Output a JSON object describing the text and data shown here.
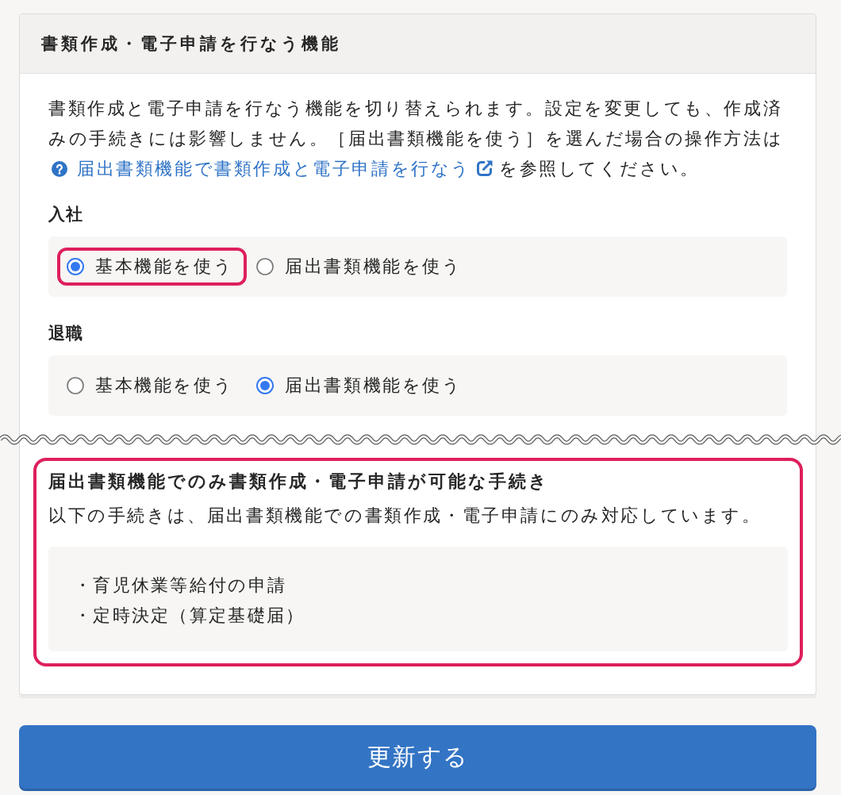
{
  "panel": {
    "title": "書類作成・電子申請を行なう機能",
    "description": {
      "text": "書類作成と電子申請を行なう機能を切り替えられます。設定を変更しても、作成済みの手続きには影響しません。［届出書類機能を使う］を選んだ場合の操作方法は",
      "link": "届出書類機能で書類作成と電子申請を行なう",
      "text_after": "を参照してください。"
    },
    "settings": [
      {
        "label": "入社",
        "options": [
          {
            "label": "基本機能を使う",
            "selected": true,
            "highlighted": true
          },
          {
            "label": "届出書類機能を使う",
            "selected": false,
            "highlighted": false
          }
        ]
      },
      {
        "label": "退職",
        "options": [
          {
            "label": "基本機能を使う",
            "selected": false,
            "highlighted": false
          },
          {
            "label": "届出書類機能を使う",
            "selected": true,
            "highlighted": false
          }
        ]
      }
    ],
    "notice": {
      "highlighted": true,
      "title": "届出書類機能でのみ書類作成・電子申請が可能な手続き",
      "text": "以下の手続きは、届出書類機能での書類作成・電子申請にのみ対応しています。",
      "items": [
        "・育児休業等給付の申請",
        "・定時決定（算定基礎届）"
      ]
    }
  },
  "submit_button": {
    "label": "更新する"
  }
}
